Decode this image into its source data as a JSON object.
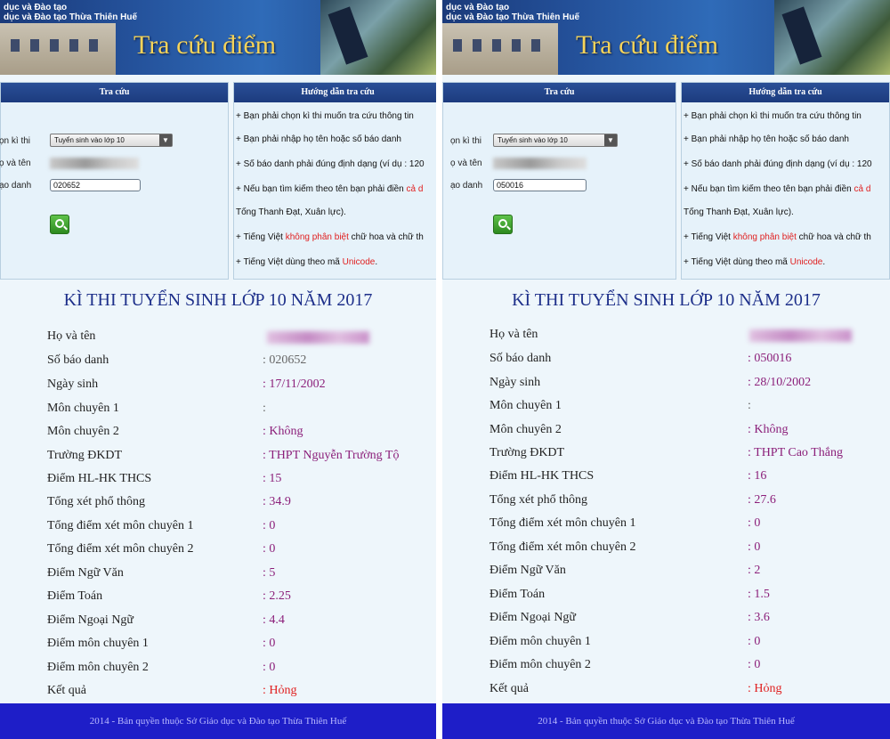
{
  "banner": {
    "org_line1": "dục và Đào tạo",
    "org_line2": "dục và Đào tạo Thừa Thiên Huế",
    "title": "Tra cứu điểm"
  },
  "search_box": {
    "header": "Tra cứu",
    "exam_label": "ọn kì thi",
    "name_label": "ọ và tên",
    "sbd_label": "ạo danh",
    "exam_selected": "Tuyển sinh vào lớp 10"
  },
  "guide": {
    "header": "Hướng dẫn tra cứu",
    "line1": "+ Bạn phải chọn kì thi muốn tra cứu thông tin",
    "line2": "+ Bạn phải nhập họ tên hoặc số báo danh",
    "line3": "+ Số báo danh phải đúng định dạng (ví dụ : 120",
    "line4_a": "+ Nếu bạn tìm kiếm theo tên bạn phải điền ",
    "line4_b": "cả d",
    "line5": "Tống Thanh Đạt, Xuân lực).",
    "line6_a": "+ Tiếng Việt ",
    "line6_b": "không phân biệt",
    "line6_c": " chữ hoa và chữ th",
    "line7_a": "+ Tiếng Việt dùng theo mã ",
    "line7_b": "Unicode",
    "line7_c": "."
  },
  "results_title": "KÌ THI TUYỂN SINH LỚP 10 NĂM 2017",
  "labels": {
    "ho_ten": "Họ và tên",
    "sbd": "Số báo danh",
    "ngay_sinh": "Ngày sinh",
    "mon_chuyen_1": "Môn chuyên 1",
    "mon_chuyen_2": "Môn chuyên 2",
    "truong": "Trường ĐKDT",
    "diem_hlhk": "Điểm HL-HK THCS",
    "tong_xet": "Tổng xét phổ thông",
    "tong_mc1": "Tổng điểm xét môn chuyên 1",
    "tong_mc2": "Tổng điểm xét môn chuyên 2",
    "ngu_van": "Điểm Ngữ Văn",
    "toan": "Điểm Toán",
    "ngoai_ngu": "Điểm Ngoại Ngữ",
    "diem_mc1": "Điểm môn chuyên 1",
    "diem_mc2": "Điểm môn chuyên 2",
    "ket_qua": "Kết quả"
  },
  "colon": ":",
  "left": {
    "sbd_input": "020652",
    "sbd": ": 020652",
    "ngay_sinh": ": 17/11/2002",
    "mon_chuyen_1": ":",
    "mon_chuyen_2": ": Không",
    "truong": ": THPT Nguyễn Trường Tộ",
    "diem_hlhk": ": 15",
    "tong_xet": ": 34.9",
    "tong_mc1": ": 0",
    "tong_mc2": ": 0",
    "ngu_van": ": 5",
    "toan": ": 2.25",
    "ngoai_ngu": ": 4.4",
    "diem_mc1": ": 0",
    "diem_mc2": ": 0",
    "ket_qua": ": Hỏng"
  },
  "right": {
    "sbd_input": "050016",
    "sbd": ": 050016",
    "ngay_sinh": ": 28/10/2002",
    "mon_chuyen_1": ":",
    "mon_chuyen_2": ": Không",
    "truong": ": THPT Cao Thắng",
    "diem_hlhk": ": 16",
    "tong_xet": ": 27.6",
    "tong_mc1": ": 0",
    "tong_mc2": ": 0",
    "ngu_van": ": 2",
    "toan": ": 1.5",
    "ngoai_ngu": ": 3.6",
    "diem_mc1": ": 0",
    "diem_mc2": ": 0",
    "ket_qua": ": Hỏng"
  },
  "footer": "2014 - Bản quyền thuộc Sở Giáo dục và Đào tạo Thừa Thiên Huế",
  "colors": {
    "header_blue": "#1c3b7e",
    "title_gold": "#f4d35a",
    "value_purple": "#8b1f7a",
    "fail_red": "#e02020",
    "footer_blue": "#1e1ec8"
  }
}
